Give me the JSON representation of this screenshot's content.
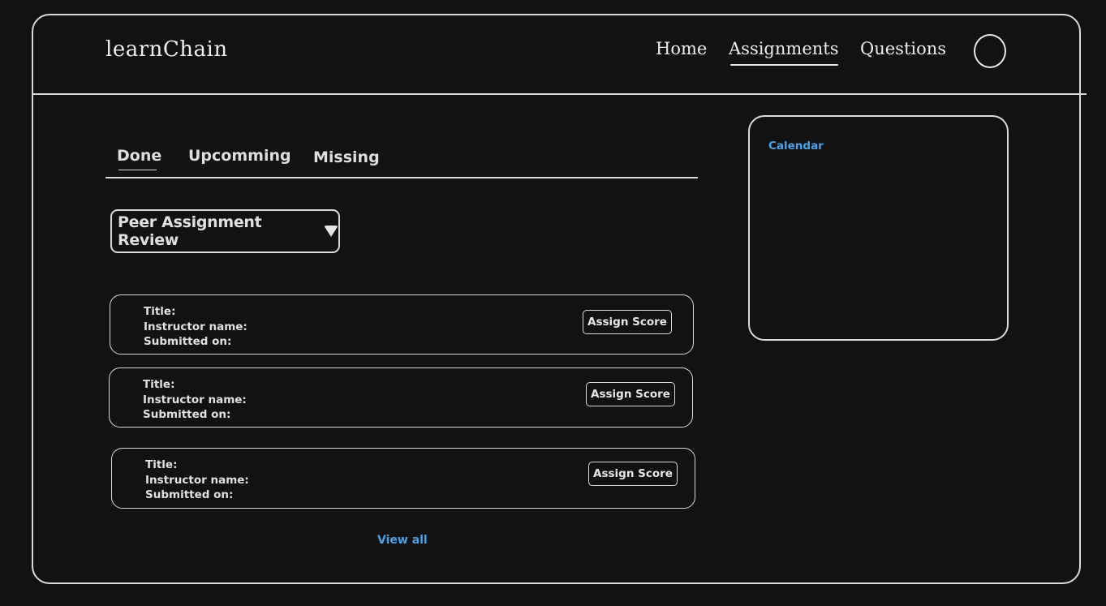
{
  "header": {
    "logo": "learnChain",
    "nav": {
      "home": "Home",
      "assignments": "Assignments",
      "questions": "Questions"
    }
  },
  "tabs": {
    "done": "Done",
    "upcoming": "Upcomming",
    "missing": "Missing"
  },
  "dropdown": {
    "label": "Peer Assignment Review"
  },
  "cards": [
    {
      "title_label": "Title:",
      "instructor_label": "Instructor name:",
      "submitted_label": "Submitted on:",
      "button": "Assign Score"
    },
    {
      "title_label": "Title:",
      "instructor_label": "Instructor name:",
      "submitted_label": "Submitted on:",
      "button": "Assign Score"
    },
    {
      "title_label": "Title:",
      "instructor_label": "Instructor name:",
      "submitted_label": "Submitted on:",
      "button": "Assign Score"
    }
  ],
  "view_all": "View all",
  "calendar": {
    "label": "Calendar"
  },
  "colors": {
    "background": "#121212",
    "stroke": "#d9d9d9",
    "link": "#4aa3e8"
  }
}
